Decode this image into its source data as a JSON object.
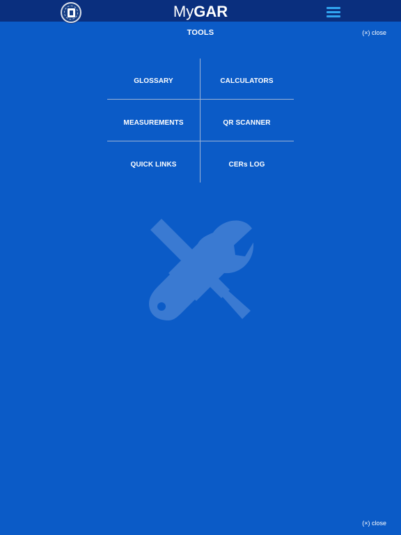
{
  "header": {
    "title_prefix": "My",
    "title_bold": "GAR"
  },
  "page": {
    "title": "TOOLS",
    "close_label": "(×) close"
  },
  "tools": [
    {
      "label": "GLOSSARY"
    },
    {
      "label": "CALCULATORS"
    },
    {
      "label": "MEASUREMENTS"
    },
    {
      "label": "QR SCANNER"
    },
    {
      "label": "QUICK LINKS"
    },
    {
      "label": "CERs LOG"
    }
  ],
  "icons": {
    "logo": "realtor-seal-icon",
    "menu": "hamburger-menu-icon",
    "watermark": "tools-wrench-screwdriver-icon"
  },
  "colors": {
    "background": "#0b5bc7",
    "header": "#0a2f7e",
    "menu_accent": "#31a6f2",
    "divider": "#9cb3d6"
  }
}
